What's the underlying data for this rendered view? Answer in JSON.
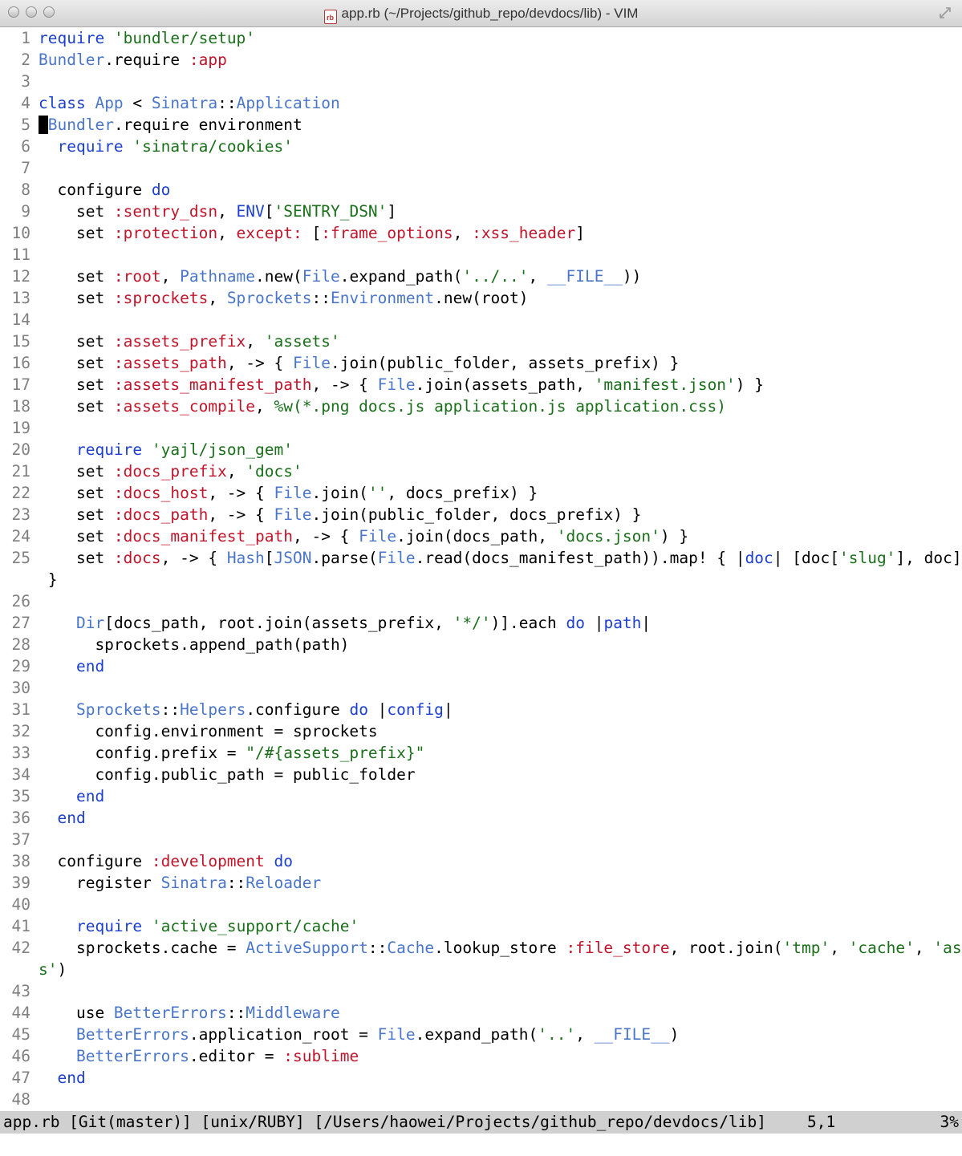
{
  "window": {
    "title": "app.rb (~/Projects/github_repo/devdocs/lib) - VIM",
    "file_icon_label": "rb"
  },
  "colors": {
    "keyword": "#1c3fcf",
    "constant": "#4a76c9",
    "symbol": "#c0152a",
    "string": "#1a6f1a",
    "plain": "#000000",
    "line_number": "#808080",
    "statusbar_bg": "#d0d0d0",
    "cursor": "#000000"
  },
  "editor": {
    "lines": [
      {
        "num": "1",
        "tokens": [
          [
            "k",
            "require"
          ],
          [
            "p",
            " "
          ],
          [
            "s",
            "'bundler/setup'"
          ]
        ]
      },
      {
        "num": "2",
        "tokens": [
          [
            "c",
            "Bundler"
          ],
          [
            "p",
            ".require "
          ],
          [
            "y",
            ":app"
          ]
        ]
      },
      {
        "num": "3",
        "tokens": []
      },
      {
        "num": "4",
        "tokens": [
          [
            "k",
            "class"
          ],
          [
            "p",
            " "
          ],
          [
            "c",
            "App"
          ],
          [
            "p",
            " < "
          ],
          [
            "c",
            "Sinatra"
          ],
          [
            "p",
            "::"
          ],
          [
            "c",
            "Application"
          ]
        ]
      },
      {
        "num": "5",
        "tokens": [
          [
            "cursor",
            " "
          ],
          [
            "c",
            "Bundler"
          ],
          [
            "p",
            ".require environment"
          ]
        ]
      },
      {
        "num": "6",
        "tokens": [
          [
            "p",
            "  "
          ],
          [
            "k",
            "require"
          ],
          [
            "p",
            " "
          ],
          [
            "s",
            "'sinatra/cookies'"
          ]
        ]
      },
      {
        "num": "7",
        "tokens": []
      },
      {
        "num": "8",
        "tokens": [
          [
            "p",
            "  configure "
          ],
          [
            "k",
            "do"
          ]
        ]
      },
      {
        "num": "9",
        "tokens": [
          [
            "p",
            "    set "
          ],
          [
            "y",
            ":sentry_dsn"
          ],
          [
            "p",
            ", "
          ],
          [
            "k",
            "ENV"
          ],
          [
            "p",
            "["
          ],
          [
            "s",
            "'SENTRY_DSN'"
          ],
          [
            "p",
            "]"
          ]
        ]
      },
      {
        "num": "10",
        "tokens": [
          [
            "p",
            "    set "
          ],
          [
            "y",
            ":protection"
          ],
          [
            "p",
            ", "
          ],
          [
            "y",
            "except:"
          ],
          [
            "p",
            " ["
          ],
          [
            "y",
            ":frame_options"
          ],
          [
            "p",
            ", "
          ],
          [
            "y",
            ":xss_header"
          ],
          [
            "p",
            "]"
          ]
        ]
      },
      {
        "num": "11",
        "tokens": []
      },
      {
        "num": "12",
        "tokens": [
          [
            "p",
            "    set "
          ],
          [
            "y",
            ":root"
          ],
          [
            "p",
            ", "
          ],
          [
            "c",
            "Pathname"
          ],
          [
            "p",
            ".new("
          ],
          [
            "c",
            "File"
          ],
          [
            "p",
            ".expand_path("
          ],
          [
            "s",
            "'../..'"
          ],
          [
            "p",
            ", "
          ],
          [
            "c",
            "__FILE__"
          ],
          [
            "p",
            "))"
          ]
        ]
      },
      {
        "num": "13",
        "tokens": [
          [
            "p",
            "    set "
          ],
          [
            "y",
            ":sprockets"
          ],
          [
            "p",
            ", "
          ],
          [
            "c",
            "Sprockets"
          ],
          [
            "p",
            "::"
          ],
          [
            "c",
            "Environment"
          ],
          [
            "p",
            ".new(root)"
          ]
        ]
      },
      {
        "num": "14",
        "tokens": []
      },
      {
        "num": "15",
        "tokens": [
          [
            "p",
            "    set "
          ],
          [
            "y",
            ":assets_prefix"
          ],
          [
            "p",
            ", "
          ],
          [
            "s",
            "'assets'"
          ]
        ]
      },
      {
        "num": "16",
        "tokens": [
          [
            "p",
            "    set "
          ],
          [
            "y",
            ":assets_path"
          ],
          [
            "p",
            ", -> { "
          ],
          [
            "c",
            "File"
          ],
          [
            "p",
            ".join(public_folder, assets_prefix) }"
          ]
        ]
      },
      {
        "num": "17",
        "tokens": [
          [
            "p",
            "    set "
          ],
          [
            "y",
            ":assets_manifest_path"
          ],
          [
            "p",
            ", -> { "
          ],
          [
            "c",
            "File"
          ],
          [
            "p",
            ".join(assets_path, "
          ],
          [
            "s",
            "'manifest.json'"
          ],
          [
            "p",
            ") }"
          ]
        ]
      },
      {
        "num": "18",
        "tokens": [
          [
            "p",
            "    set "
          ],
          [
            "y",
            ":assets_compile"
          ],
          [
            "p",
            ", "
          ],
          [
            "s",
            "%w(*.png docs.js application.js application.css)"
          ]
        ]
      },
      {
        "num": "19",
        "tokens": []
      },
      {
        "num": "20",
        "tokens": [
          [
            "p",
            "    "
          ],
          [
            "k",
            "require"
          ],
          [
            "p",
            " "
          ],
          [
            "s",
            "'yajl/json_gem'"
          ]
        ]
      },
      {
        "num": "21",
        "tokens": [
          [
            "p",
            "    set "
          ],
          [
            "y",
            ":docs_prefix"
          ],
          [
            "p",
            ", "
          ],
          [
            "s",
            "'docs'"
          ]
        ]
      },
      {
        "num": "22",
        "tokens": [
          [
            "p",
            "    set "
          ],
          [
            "y",
            ":docs_host"
          ],
          [
            "p",
            ", -> { "
          ],
          [
            "c",
            "File"
          ],
          [
            "p",
            ".join("
          ],
          [
            "s",
            "''"
          ],
          [
            "p",
            ", docs_prefix) }"
          ]
        ]
      },
      {
        "num": "23",
        "tokens": [
          [
            "p",
            "    set "
          ],
          [
            "y",
            ":docs_path"
          ],
          [
            "p",
            ", -> { "
          ],
          [
            "c",
            "File"
          ],
          [
            "p",
            ".join(public_folder, docs_prefix) }"
          ]
        ]
      },
      {
        "num": "24",
        "tokens": [
          [
            "p",
            "    set "
          ],
          [
            "y",
            ":docs_manifest_path"
          ],
          [
            "p",
            ", -> { "
          ],
          [
            "c",
            "File"
          ],
          [
            "p",
            ".join(docs_path, "
          ],
          [
            "s",
            "'docs.json'"
          ],
          [
            "p",
            ") }"
          ]
        ]
      },
      {
        "num": "25",
        "tokens": [
          [
            "p",
            "    set "
          ],
          [
            "y",
            ":docs"
          ],
          [
            "p",
            ", -> { "
          ],
          [
            "c",
            "Hash"
          ],
          [
            "p",
            "["
          ],
          [
            "c",
            "JSON"
          ],
          [
            "p",
            ".parse("
          ],
          [
            "c",
            "File"
          ],
          [
            "p",
            ".read(docs_manifest_path)).map! { |"
          ],
          [
            "k",
            "doc"
          ],
          [
            "p",
            "| [doc["
          ],
          [
            "s",
            "'slug'"
          ],
          [
            "p",
            "], doc] }]"
          ]
        ]
      },
      {
        "num": "",
        "tokens": [
          [
            "p",
            " }"
          ]
        ]
      },
      {
        "num": "26",
        "tokens": []
      },
      {
        "num": "27",
        "tokens": [
          [
            "p",
            "    "
          ],
          [
            "c",
            "Dir"
          ],
          [
            "p",
            "[docs_path, root.join(assets_prefix, "
          ],
          [
            "s",
            "'*/'"
          ],
          [
            "p",
            ")].each "
          ],
          [
            "k",
            "do"
          ],
          [
            "p",
            " |"
          ],
          [
            "k",
            "path"
          ],
          [
            "p",
            "|"
          ]
        ]
      },
      {
        "num": "28",
        "tokens": [
          [
            "p",
            "      sprockets.append_path(path)"
          ]
        ]
      },
      {
        "num": "29",
        "tokens": [
          [
            "p",
            "    "
          ],
          [
            "k",
            "end"
          ]
        ]
      },
      {
        "num": "30",
        "tokens": []
      },
      {
        "num": "31",
        "tokens": [
          [
            "p",
            "    "
          ],
          [
            "c",
            "Sprockets"
          ],
          [
            "p",
            "::"
          ],
          [
            "c",
            "Helpers"
          ],
          [
            "p",
            ".configure "
          ],
          [
            "k",
            "do"
          ],
          [
            "p",
            " |"
          ],
          [
            "k",
            "config"
          ],
          [
            "p",
            "|"
          ]
        ]
      },
      {
        "num": "32",
        "tokens": [
          [
            "p",
            "      config.environment = sprockets"
          ]
        ]
      },
      {
        "num": "33",
        "tokens": [
          [
            "p",
            "      config.prefix = "
          ],
          [
            "s",
            "\"/#{assets_prefix}\""
          ]
        ]
      },
      {
        "num": "34",
        "tokens": [
          [
            "p",
            "      config.public_path = public_folder"
          ]
        ]
      },
      {
        "num": "35",
        "tokens": [
          [
            "p",
            "    "
          ],
          [
            "k",
            "end"
          ]
        ]
      },
      {
        "num": "36",
        "tokens": [
          [
            "p",
            "  "
          ],
          [
            "k",
            "end"
          ]
        ]
      },
      {
        "num": "37",
        "tokens": []
      },
      {
        "num": "38",
        "tokens": [
          [
            "p",
            "  configure "
          ],
          [
            "y",
            ":development"
          ],
          [
            "p",
            " "
          ],
          [
            "k",
            "do"
          ]
        ]
      },
      {
        "num": "39",
        "tokens": [
          [
            "p",
            "    register "
          ],
          [
            "c",
            "Sinatra"
          ],
          [
            "p",
            "::"
          ],
          [
            "c",
            "Reloader"
          ]
        ]
      },
      {
        "num": "40",
        "tokens": []
      },
      {
        "num": "41",
        "tokens": [
          [
            "p",
            "    "
          ],
          [
            "k",
            "require"
          ],
          [
            "p",
            " "
          ],
          [
            "s",
            "'active_support/cache'"
          ]
        ]
      },
      {
        "num": "42",
        "tokens": [
          [
            "p",
            "    sprockets.cache = "
          ],
          [
            "c",
            "ActiveSupport"
          ],
          [
            "p",
            "::"
          ],
          [
            "c",
            "Cache"
          ],
          [
            "p",
            ".lookup_store "
          ],
          [
            "y",
            ":file_store"
          ],
          [
            "p",
            ", root.join("
          ],
          [
            "s",
            "'tmp'"
          ],
          [
            "p",
            ", "
          ],
          [
            "s",
            "'cache'"
          ],
          [
            "p",
            ", "
          ],
          [
            "s",
            "'asset"
          ]
        ]
      },
      {
        "num": "",
        "tokens": [
          [
            "s",
            "s'"
          ],
          [
            "p",
            ")"
          ]
        ]
      },
      {
        "num": "43",
        "tokens": []
      },
      {
        "num": "44",
        "tokens": [
          [
            "p",
            "    use "
          ],
          [
            "c",
            "BetterErrors"
          ],
          [
            "p",
            "::"
          ],
          [
            "c",
            "Middleware"
          ]
        ]
      },
      {
        "num": "45",
        "tokens": [
          [
            "p",
            "    "
          ],
          [
            "c",
            "BetterErrors"
          ],
          [
            "p",
            ".application_root = "
          ],
          [
            "c",
            "File"
          ],
          [
            "p",
            ".expand_path("
          ],
          [
            "s",
            "'..'"
          ],
          [
            "p",
            ", "
          ],
          [
            "c",
            "__FILE__"
          ],
          [
            "p",
            ")"
          ]
        ]
      },
      {
        "num": "46",
        "tokens": [
          [
            "p",
            "    "
          ],
          [
            "c",
            "BetterErrors"
          ],
          [
            "p",
            ".editor = "
          ],
          [
            "y",
            ":sublime"
          ]
        ]
      },
      {
        "num": "47",
        "tokens": [
          [
            "p",
            "  "
          ],
          [
            "k",
            "end"
          ]
        ]
      },
      {
        "num": "48",
        "tokens": []
      }
    ]
  },
  "statusbar": {
    "left": "app.rb [Git(master)] [unix/RUBY] [/Users/haowei/Projects/github_repo/devdocs/lib]",
    "position": "5,1",
    "percent": "3%"
  }
}
